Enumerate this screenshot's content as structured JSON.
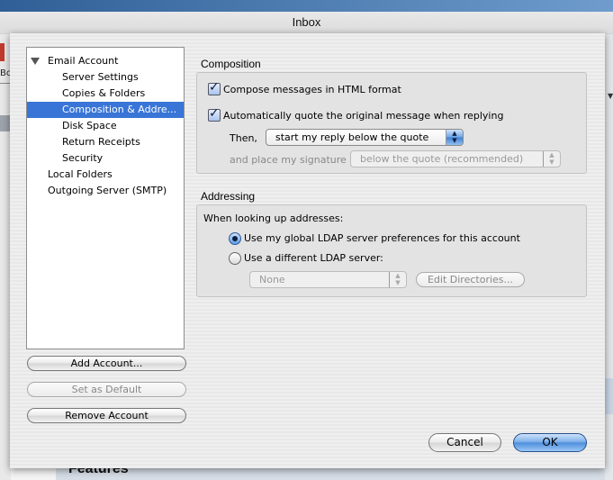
{
  "window": {
    "title": "Inbox"
  },
  "background": {
    "left_fragment": "Bc",
    "features_heading": "Features"
  },
  "tree": {
    "items": [
      {
        "label": "Email Account",
        "level": 0,
        "expanded": true
      },
      {
        "label": "Server Settings",
        "level": 1
      },
      {
        "label": "Copies & Folders",
        "level": 1
      },
      {
        "label": "Composition & Addre...",
        "level": 1,
        "selected": true
      },
      {
        "label": "Disk Space",
        "level": 1
      },
      {
        "label": "Return Receipts",
        "level": 1
      },
      {
        "label": "Security",
        "level": 1
      },
      {
        "label": "Local Folders",
        "level": 0
      },
      {
        "label": "Outgoing Server (SMTP)",
        "level": 0
      }
    ]
  },
  "account_buttons": {
    "add": "Add Account...",
    "set_default": "Set as Default",
    "remove": "Remove Account"
  },
  "composition": {
    "heading": "Composition",
    "html_format": {
      "label": "Compose messages in HTML format",
      "checked": true
    },
    "auto_quote": {
      "label": "Automatically quote the original message when replying",
      "checked": true
    },
    "then_label": "Then,",
    "reply_position": "start my reply below the quote",
    "signature_label": "and place my signature",
    "signature_position": "below the quote (recommended)"
  },
  "addressing": {
    "heading": "Addressing",
    "lookup_label": "When looking up addresses:",
    "global_ldap": {
      "label": "Use my global LDAP server preferences for this account",
      "selected": true
    },
    "different_ldap": {
      "label": "Use a different LDAP server:",
      "selected": false
    },
    "ldap_server": "None",
    "edit_directories": "Edit Directories..."
  },
  "dialog_buttons": {
    "cancel": "Cancel",
    "ok": "OK"
  },
  "colors": {
    "selection": "#3875d7",
    "default_button": "#4f8fdc"
  }
}
